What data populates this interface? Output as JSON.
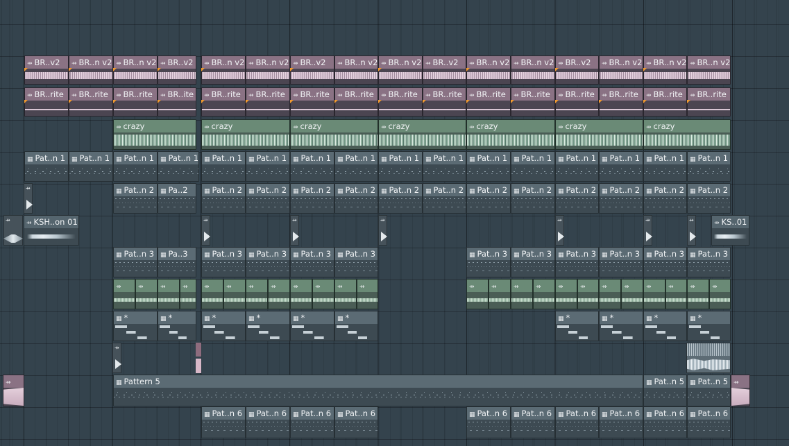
{
  "playlist": {
    "colors": {
      "background": "#34434d",
      "audio_clip_pink": "#8a7284",
      "audio_clip_green": "#6a8a76",
      "pattern_clip": "#5b6b74",
      "slice_marker": "#f09a30"
    },
    "icons": {
      "audio_clip": "audio-clip-icon",
      "pattern_clip": "pattern-clip-icon"
    },
    "clip_names": {
      "br_v2": "BR..v2",
      "br_n_v2": "BR..n v2",
      "br_rite": "BR..rite",
      "br_ite": "BR..ite",
      "crazy": "crazy",
      "pat_n1": "Pat..n 1",
      "pat_n2": "Pat..n 2",
      "pa_2": "Pa..2",
      "ksh_on_01": "KSH..on 01",
      "ks_01": "KS..01",
      "pat_n3": "Pat..n 3",
      "pa_3": "Pa..3",
      "star": "*",
      "pattern_5": "Pattern 5",
      "pat_n5": "Pat..n 5",
      "pat_n6": "Pat..n 6"
    }
  }
}
